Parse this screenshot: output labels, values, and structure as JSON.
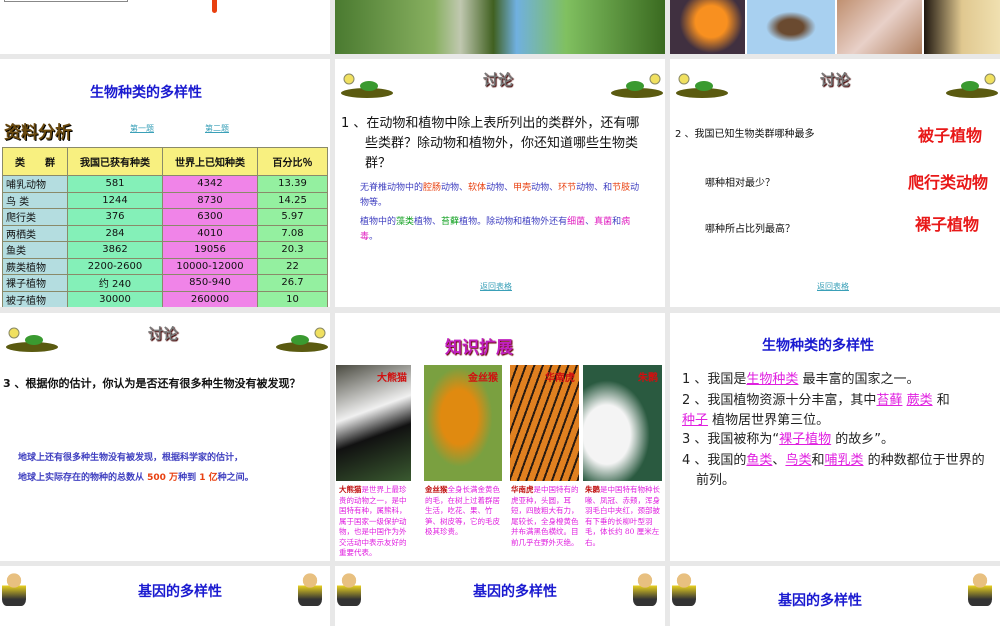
{
  "slides": {
    "s1": {
      "title": "生物种类的多样性",
      "label": "资料分析",
      "link1": "第一题",
      "link2": "第二题",
      "headers": [
        "类　　群",
        "我国已获有种类",
        "世界上已知种类",
        "百分比％"
      ],
      "rows": [
        [
          "哺乳动物",
          "581",
          "4342",
          "13.39"
        ],
        [
          "鸟 类",
          "1244",
          "8730",
          "14.25"
        ],
        [
          "爬行类",
          "376",
          "6300",
          "5.97"
        ],
        [
          "两栖类",
          "284",
          "4010",
          "7.08"
        ],
        [
          "鱼类",
          "3862",
          "19056",
          "20.3"
        ],
        [
          "蕨类植物",
          "2200-2600",
          "10000-12000",
          "22"
        ],
        [
          "裸子植物",
          "约 240",
          "850-940",
          "26.7"
        ],
        [
          "被子植物",
          "30000",
          "260000",
          "10"
        ]
      ]
    },
    "s2": {
      "heading": "讨论",
      "q": "1 、在动物和植物中除上表所列出的类群外，还有哪些类群？除动物和植物外，你还知道哪些生物类群？",
      "a1": [
        "无脊椎动物中的",
        "腔肠",
        "动物、",
        "软体",
        "动物、",
        "甲壳",
        "动物、",
        "环节",
        "动物、和",
        "节肢",
        "动物等。"
      ],
      "a2": [
        "植物中的",
        "藻类",
        "植物、",
        "苔藓",
        "植物。除动物和植物外还有",
        "细菌",
        "、",
        "真菌",
        "和",
        "病毒",
        "。"
      ],
      "link": "返回表格"
    },
    "s3": {
      "heading": "讨论",
      "q1": "2 、我国已知生物类群哪种最多",
      "q2": "哪种相对最少？",
      "q3": "哪种所占比列最高？",
      "a1": "被子植物",
      "a2": "爬行类动物",
      "a3": "裸子植物",
      "link": "返回表格"
    },
    "s4": {
      "heading": "讨论",
      "q": "3 、根据你的估计，你认为是否还有很多种生物没有被发现？",
      "a1": "地球上还有很多种生物没有被发现，根据科学家的估计，",
      "a2a": "地球上实际存在的物种的总数从 ",
      "n1": "500 万",
      "a2b": "种到 ",
      "n2": "1 亿",
      "a2c": "种之间。"
    },
    "s5": {
      "title": "知识扩展",
      "animals": [
        {
          "name": "大熊猫",
          "desc": "是世界上最珍贵的动物之一，是中国特有种，属熊科，属于国家一级保护动物，也是中国作为外交活动中表示友好的重要代表。"
        },
        {
          "name": "金丝猴",
          "desc": "全身长满金黄色的毛，在树上过着群居生活，吃花、果、竹笋、树皮等，它的毛皮极其珍贵。"
        },
        {
          "name": "华南虎",
          "desc": "是中国特有的虎亚种，头圆，耳短，四肢粗大有力，尾较长，全身橙黄色并布满黑色横纹。目前几乎在野外灭绝。"
        },
        {
          "name": "朱鹮",
          "desc": "是中国特有物种长喙、凤冠、赤颊，浑身羽毛白中夹红，颈部披有下垂的长柳叶型羽毛，体长约 80 厘米左右。"
        }
      ]
    },
    "s6": {
      "title": "生物种类的多样性",
      "l1a": "1 、我国是",
      "f1": "生物种类",
      "l1b": " 最丰富的国家之一。",
      "l2a": "2 、我国植物资源十分丰富，其中",
      "f2": "苔藓",
      "f3": "蕨类",
      "l2b": " 和 ",
      "f4": "种子",
      "l2c": " 植物居世界第三位。",
      "l3a": "3 、我国被称为“",
      "f5": "裸子植物",
      "l3b": " 的故乡”。",
      "l4a": "4 、我国的",
      "f6": "鱼类",
      "f7": "鸟类",
      "f8": "哺乳类",
      "l4b": " 的种数都位于世界的前列。"
    },
    "s7": {
      "title": "基因的多样性"
    },
    "s8": {
      "title": "基因的多样性"
    },
    "s9": {
      "title": "基因的多样性"
    }
  }
}
